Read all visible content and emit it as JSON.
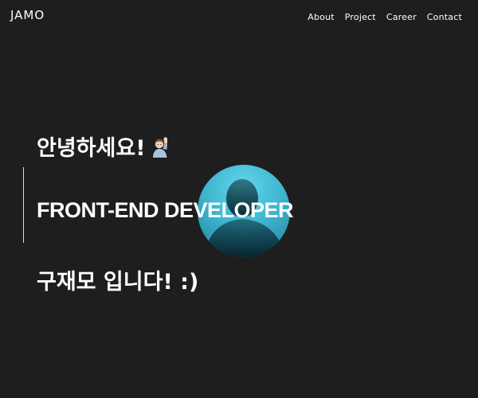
{
  "header": {
    "logo": "JAMO",
    "nav": [
      "About",
      "Project",
      "Career",
      "Contact"
    ]
  },
  "hero": {
    "greeting": "안녕하세요!",
    "role": "FRONT-END DEVELOPER",
    "intro": "구재모 입니다! :)",
    "emoji_icon": "man-raising-hand-icon",
    "avatar_icon": "profile-silhouette-avatar"
  },
  "colors": {
    "background": "#1e1e1f",
    "text": "#ffffff",
    "avatar_accent": "#4cc6de"
  }
}
